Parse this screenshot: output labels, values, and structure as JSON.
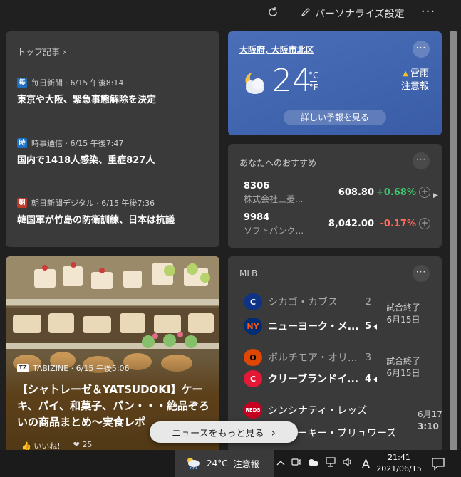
{
  "toolbar": {
    "refresh_icon": "refresh-icon",
    "personalize_label": "パーソナライズ設定",
    "more_label": "···"
  },
  "top_stories": {
    "header": "トップ記事",
    "items": [
      {
        "logo_char": "毎",
        "logo_color": "#1f6fc0",
        "source": "毎日新聞 · 6/15 午後8:14",
        "title": "東京や大阪、緊急事態解除を決定"
      },
      {
        "logo_char": "時",
        "logo_color": "#1a73c9",
        "source": "時事通信 · 6/15 午後7:47",
        "title": "国内で1418人感染、重症827人"
      },
      {
        "logo_char": "朝",
        "logo_color": "#c0392b",
        "source": "朝日新聞デジタル · 6/15 午後7:36",
        "title": "韓国軍が竹島の防衛訓練、日本は抗議"
      }
    ]
  },
  "weather": {
    "location": "大阪府, 大阪市北区",
    "temperature": "24",
    "unit_c": "°C",
    "unit_f": "°F",
    "condition_icon": "partly-cloudy-night-icon",
    "alert_line1": "雷雨",
    "alert_line2": "注意報",
    "forecast_button": "詳しい予報を見る",
    "menu": "···"
  },
  "recommendations": {
    "header": "あなたへのおすすめ",
    "menu": "···",
    "stocks": [
      {
        "code": "8306",
        "name": "株式会社三菱...",
        "price": "608.80",
        "change": "+0.68%",
        "change_color": "#3ec46d"
      },
      {
        "code": "9984",
        "name": "ソフトバンク...",
        "price": "8,042.00",
        "change": "-0.17%",
        "change_color": "#ff6b5e"
      }
    ],
    "plus": "+",
    "next_arrow": "▶"
  },
  "image_news": {
    "source_logo": "TZ",
    "source": "TABIZINE · 6/15 午後5:06",
    "title": "【シャトレーゼ＆YATSUDOKI】ケーキ、パイ、和菓子、パン・・・絶品ぞろいの商品まとめ〜実食レポ",
    "like_label": "いいね!",
    "reaction_count": "25"
  },
  "mlb": {
    "header": "MLB",
    "menu": "···",
    "games": [
      {
        "status_line1": "試合終了",
        "status_line2": "6月15日",
        "teams": [
          {
            "name": "シカゴ・カブス",
            "score": "2",
            "result": "lose",
            "logo": "C",
            "logo_bg": "#0e3386",
            "logo_fg": "#fff"
          },
          {
            "name": "ニューヨーク・メ...",
            "score": "5",
            "result": "win",
            "logo": "NY",
            "logo_bg": "#002d72",
            "logo_fg": "#ff5910"
          }
        ]
      },
      {
        "status_line1": "試合終了",
        "status_line2": "6月15日",
        "teams": [
          {
            "name": "ボルチモア・オリ...",
            "score": "3",
            "result": "lose",
            "logo": "O",
            "logo_bg": "#df4601",
            "logo_fg": "#000"
          },
          {
            "name": "クリーブランドイ...",
            "score": "4",
            "result": "win",
            "logo": "C",
            "logo_bg": "#e31937",
            "logo_fg": "#fff"
          }
        ]
      },
      {
        "status_line1": "6月17",
        "status_line2": "3:10",
        "teams": [
          {
            "name": "シンシナティ・レッズ",
            "score": "",
            "result": "lose",
            "logo": "REDS",
            "logo_bg": "#c6011f",
            "logo_fg": "#fff"
          },
          {
            "name": "ミルウォーキー・ブリュワーズ",
            "score": "",
            "result": "lose",
            "logo": "M",
            "logo_bg": "#12284b",
            "logo_fg": "#ffc52f"
          }
        ]
      }
    ]
  },
  "see_more": {
    "label": "ニュースをもっと見る",
    "chevron": "›"
  },
  "taskbar": {
    "weather_temp": "24°C",
    "weather_label": "注意報",
    "tray_chevron": "^",
    "ime_label": "A",
    "time": "21:41",
    "date": "2021/06/15"
  }
}
